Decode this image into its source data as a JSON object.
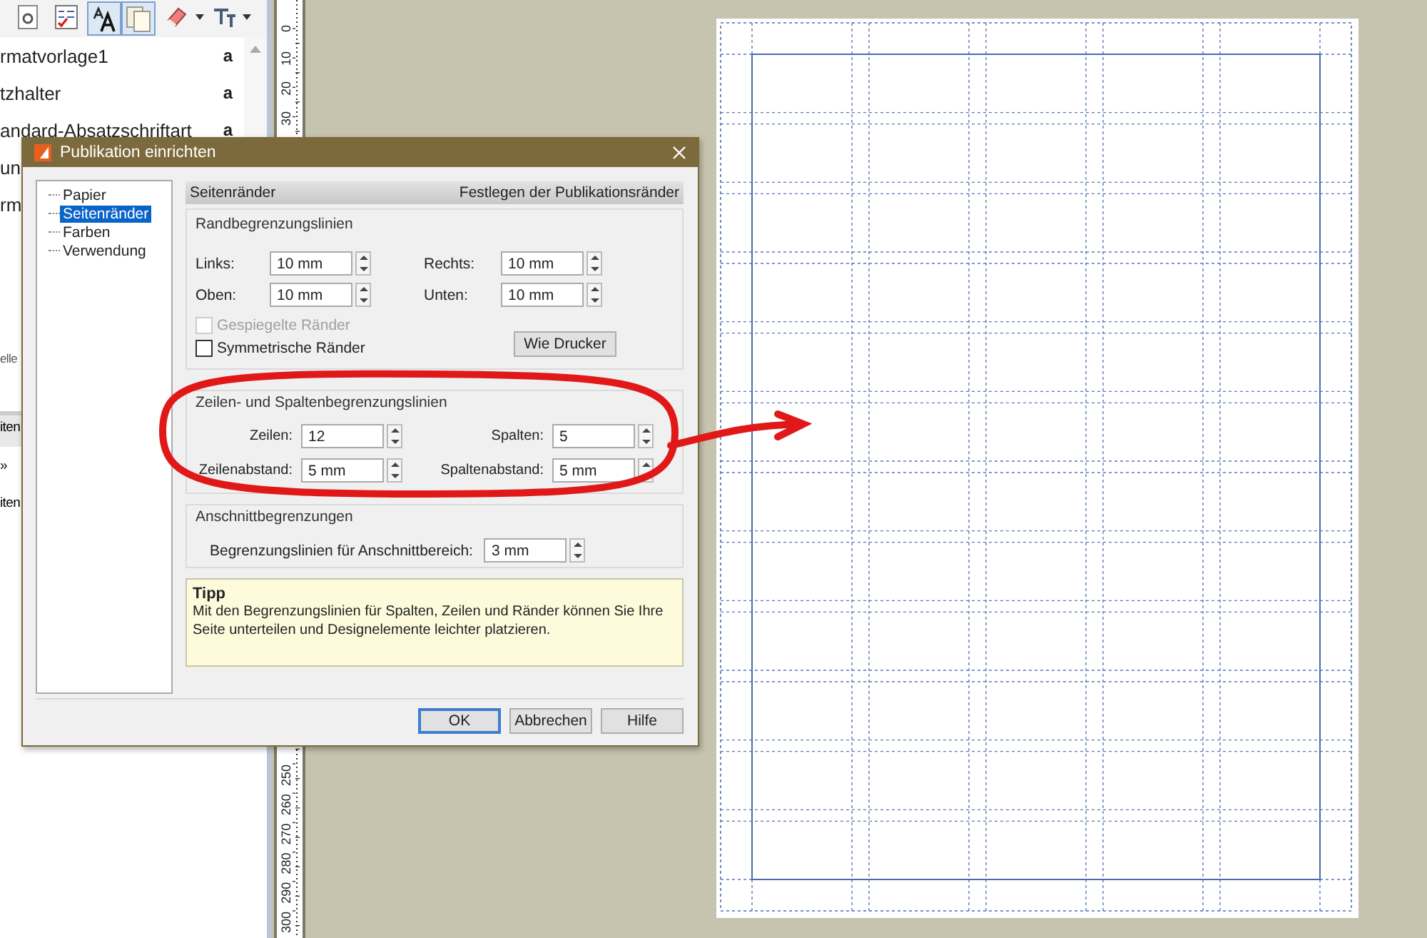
{
  "styles_list": [
    {
      "label": "rmatvorlage1",
      "marker": "a"
    },
    {
      "label": "tzhalter",
      "marker": "a"
    },
    {
      "label": "andard-Absatzschriftart",
      "marker": "a"
    },
    {
      "label": "un"
    },
    {
      "label": "rm"
    }
  ],
  "lower_panel": {
    "top_text": "elle",
    "header": "iten",
    "items": [
      "»",
      "iten"
    ]
  },
  "ruler": {
    "top_labels": [
      "0",
      "10",
      "20",
      "30"
    ],
    "bottom_labels": [
      "250",
      "260",
      "270",
      "280",
      "290",
      "300"
    ]
  },
  "dialog": {
    "title": "Publikation einrichten",
    "nav": [
      {
        "label": "Papier",
        "selected": false
      },
      {
        "label": "Seitenränder",
        "selected": true
      },
      {
        "label": "Farben",
        "selected": false
      },
      {
        "label": "Verwendung",
        "selected": false
      }
    ],
    "header": {
      "title": "Seitenränder",
      "description": "Festlegen der Publikationsränder"
    },
    "margins": {
      "legend": "Randbegrenzungslinien",
      "fields": [
        {
          "label": "Links:",
          "value": "10 mm"
        },
        {
          "label": "Rechts:",
          "value": "10 mm"
        },
        {
          "label": "Oben:",
          "value": "10 mm"
        },
        {
          "label": "Unten:",
          "value": "10 mm"
        }
      ],
      "checkboxes": [
        {
          "label": "Gespiegelte Ränder",
          "checked": false,
          "disabled": true
        },
        {
          "label": "Symmetrische Ränder",
          "checked": false,
          "disabled": false
        }
      ],
      "button": "Wie Drucker"
    },
    "grid_guides": {
      "legend": "Zeilen- und Spaltenbegrenzungslinien",
      "fields": [
        {
          "label": "Zeilen:",
          "value": "12"
        },
        {
          "label": "Spalten:",
          "value": "5"
        },
        {
          "label": "Zeilenabstand:",
          "value": "5 mm"
        },
        {
          "label": "Spaltenabstand:",
          "value": "5 mm"
        }
      ]
    },
    "bleed": {
      "legend": "Anschnittbegrenzungen",
      "field": {
        "label": "Begrenzungslinien für Anschnittbereich:",
        "value": "3 mm"
      }
    },
    "tip": {
      "title": "Tipp",
      "text": "Mit den Begrenzungslinien für Spalten, Zeilen und Ränder können Sie Ihre Seite unterteilen und Designelemente leichter platzieren."
    },
    "buttons": [
      {
        "label": "OK",
        "default": true
      },
      {
        "label": "Abbrechen",
        "default": false
      },
      {
        "label": "Hilfe",
        "default": false
      }
    ]
  }
}
